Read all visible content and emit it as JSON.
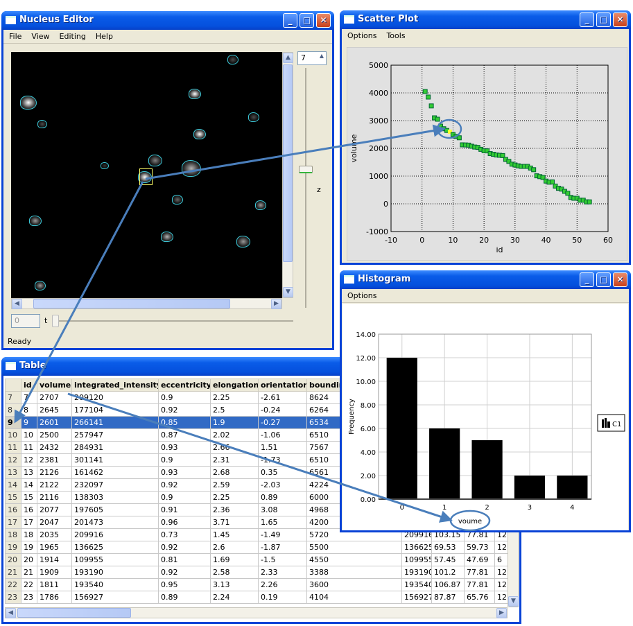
{
  "nucleus_editor": {
    "title": "Nucleus Editor",
    "menu": [
      "File",
      "View",
      "Editing",
      "Help"
    ],
    "z_value": "7",
    "z_label": "z",
    "t_value": "0",
    "t_label": "t",
    "status": "Ready",
    "selection_color": "#ffff66",
    "outline_color": "#3cc8d8"
  },
  "scatter": {
    "title": "Scatter Plot",
    "menu": [
      "Options",
      "Tools"
    ]
  },
  "histogram": {
    "title": "Histogram",
    "menu": [
      "Options"
    ],
    "legend": "C1"
  },
  "table": {
    "title": "Table",
    "columns": [
      "",
      "id",
      "volume",
      "integrated_intensity",
      "eccentricity",
      "elongation",
      "orientation",
      "boundin",
      "",
      "",
      "",
      ""
    ],
    "selected_row": "9",
    "rows": [
      [
        "7",
        "7",
        "2707",
        "209120",
        "0.9",
        "2.25",
        "-2.61",
        "8624",
        "",
        "",
        "",
        ""
      ],
      [
        "8",
        "8",
        "2645",
        "177104",
        "0.92",
        "2.5",
        "-0.24",
        "6264",
        "",
        "",
        "",
        ""
      ],
      [
        "9",
        "9",
        "2601",
        "266141",
        "0.85",
        "1.9",
        "-0.27",
        "6534",
        "",
        "",
        "",
        ""
      ],
      [
        "10",
        "10",
        "2500",
        "257947",
        "0.87",
        "2.02",
        "-1.06",
        "6510",
        "",
        "",
        "",
        ""
      ],
      [
        "11",
        "11",
        "2432",
        "284931",
        "0.93",
        "2.66",
        "1.51",
        "7567",
        "",
        "",
        "",
        ""
      ],
      [
        "12",
        "12",
        "2381",
        "301141",
        "0.9",
        "2.31",
        "-1.73",
        "6510",
        "",
        "",
        "",
        ""
      ],
      [
        "13",
        "13",
        "2126",
        "161462",
        "0.93",
        "2.68",
        "0.35",
        "6561",
        "",
        "",
        "",
        ""
      ],
      [
        "14",
        "14",
        "2122",
        "232097",
        "0.92",
        "2.59",
        "-2.03",
        "4224",
        "",
        "",
        "",
        ""
      ],
      [
        "15",
        "15",
        "2116",
        "138303",
        "0.9",
        "2.25",
        "0.89",
        "6000",
        "",
        "",
        "",
        ""
      ],
      [
        "16",
        "16",
        "2077",
        "197605",
        "0.91",
        "2.36",
        "3.08",
        "4968",
        "",
        "",
        "",
        ""
      ],
      [
        "17",
        "17",
        "2047",
        "201473",
        "0.96",
        "3.71",
        "1.65",
        "4200",
        "",
        "",
        "",
        ""
      ],
      [
        "18",
        "18",
        "2035",
        "209916",
        "0.73",
        "1.45",
        "-1.49",
        "5720",
        "209916",
        "103.15",
        "77.81",
        "12"
      ],
      [
        "19",
        "19",
        "1965",
        "136625",
        "0.92",
        "2.6",
        "-1.87",
        "5500",
        "136625",
        "69.53",
        "59.73",
        "12"
      ],
      [
        "20",
        "20",
        "1914",
        "109955",
        "0.81",
        "1.69",
        "-1.5",
        "4550",
        "109955",
        "57.45",
        "47.69",
        "6"
      ],
      [
        "21",
        "21",
        "1909",
        "193190",
        "0.92",
        "2.58",
        "2.33",
        "3388",
        "193190",
        "101.2",
        "77.81",
        "12"
      ],
      [
        "22",
        "22",
        "1811",
        "193540",
        "0.95",
        "3.13",
        "2.26",
        "3600",
        "193540",
        "106.87",
        "77.81",
        "12"
      ],
      [
        "23",
        "23",
        "1786",
        "156927",
        "0.89",
        "2.24",
        "0.19",
        "4104",
        "156927",
        "87.87",
        "65.76",
        "12"
      ]
    ]
  },
  "annotation_color": "#4a7ebb",
  "chart_data": [
    {
      "type": "scatter",
      "xlabel": "id",
      "ylabel": "volume",
      "xlim": [
        -10,
        60
      ],
      "ylim": [
        -1000,
        5000
      ],
      "xticks": [
        -10,
        0,
        10,
        20,
        30,
        40,
        50,
        60
      ],
      "yticks": [
        -1000,
        0,
        1000,
        2000,
        3000,
        4000,
        5000
      ],
      "grid": true,
      "point_color": "#33cc33",
      "highlight_color": "#ffff33",
      "highlight_id": 9,
      "x": [
        1,
        2,
        3,
        4,
        5,
        6,
        7,
        8,
        9,
        10,
        11,
        12,
        13,
        14,
        15,
        16,
        17,
        18,
        19,
        20,
        21,
        22,
        23,
        24,
        25,
        26,
        27,
        28,
        29,
        30,
        31,
        32,
        33,
        34,
        35,
        36,
        37,
        38,
        39,
        40,
        41,
        42,
        43,
        44,
        45,
        46,
        47,
        48,
        49,
        50,
        51,
        52,
        53,
        54
      ],
      "y": [
        4050,
        3850,
        3530,
        3100,
        3050,
        2800,
        2707,
        2645,
        2601,
        2500,
        2432,
        2381,
        2126,
        2122,
        2116,
        2077,
        2047,
        2035,
        1965,
        1914,
        1909,
        1811,
        1786,
        1760,
        1750,
        1740,
        1600,
        1530,
        1430,
        1400,
        1370,
        1350,
        1350,
        1350,
        1290,
        1230,
        1010,
        980,
        950,
        820,
        780,
        790,
        640,
        560,
        530,
        450,
        380,
        230,
        200,
        200,
        130,
        130,
        70,
        70
      ]
    },
    {
      "type": "bar",
      "xlabel": "voume",
      "ylabel": "Frequency",
      "categories": [
        "0",
        "1",
        "2",
        "3",
        "4"
      ],
      "values": [
        12,
        6,
        5,
        2,
        2
      ],
      "ylim": [
        0,
        14
      ],
      "yticks": [
        "0.00",
        "2.00",
        "4.00",
        "6.00",
        "8.00",
        "10.00",
        "12.00",
        "14.00"
      ],
      "legend": "C1",
      "legend_placement": "right",
      "bar_color": "#000000",
      "grid": true
    }
  ]
}
